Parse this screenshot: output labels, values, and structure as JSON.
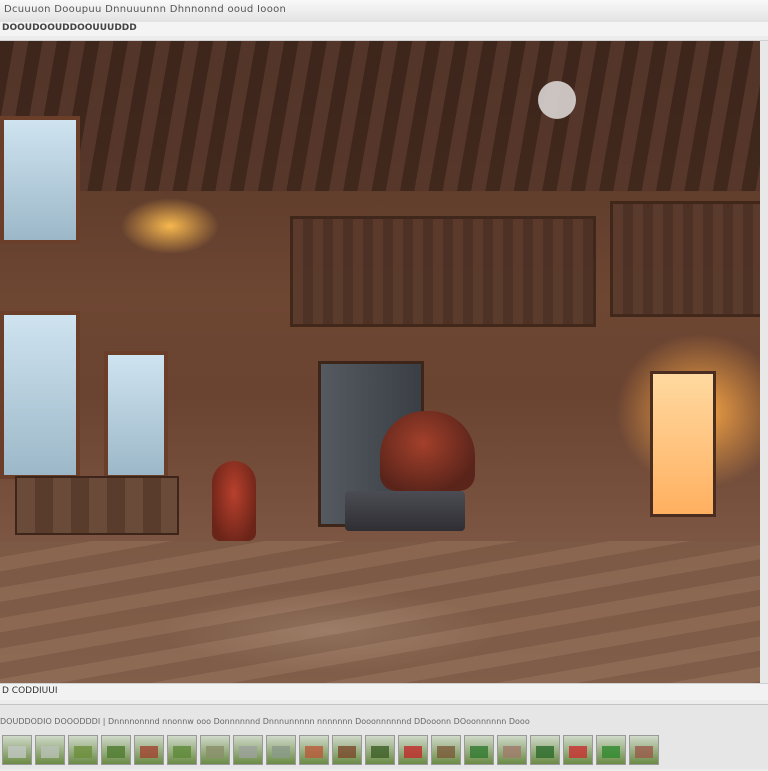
{
  "window": {
    "title": "Dcuuuon Dooupuu Dnnuuunnn Dhnnonnd ooud Iooon"
  },
  "toolbar": {
    "path_label": "DOOUDOOUDDOOUUUDDD"
  },
  "viewer": {
    "image_name": "rendered interior scene"
  },
  "status": {
    "text": "D CODDIUUI"
  },
  "filmstrip": {
    "caption": "DOUDDODIO DOOODDDI |  Dnnnnonnnd nnonnw ooo Donnnnnnd Dnnnunnnnn nnnnnnn Dooonnnnnnd        DDooonn   DOoonnnnnn  Dooo"
  },
  "thumbnails": [
    {
      "icon": "image-thumbnail",
      "accent": "#c0c7c2"
    },
    {
      "icon": "image-thumbnail",
      "accent": "#b9c0b6"
    },
    {
      "icon": "image-thumbnail",
      "accent": "#6b8f3a"
    },
    {
      "icon": "image-thumbnail",
      "accent": "#4e7a2e"
    },
    {
      "icon": "image-thumbnail",
      "accent": "#a04530"
    },
    {
      "icon": "image-thumbnail",
      "accent": "#5c8a37"
    },
    {
      "icon": "image-thumbnail",
      "accent": "#8a8f6a"
    },
    {
      "icon": "image-thumbnail",
      "accent": "#9ca09c"
    },
    {
      "icon": "image-thumbnail",
      "accent": "#8a9a88"
    },
    {
      "icon": "image-thumbnail",
      "accent": "#b95a3a"
    },
    {
      "icon": "image-thumbnail",
      "accent": "#7a4a2a"
    },
    {
      "icon": "image-thumbnail",
      "accent": "#3c5f27"
    },
    {
      "icon": "image-thumbnail",
      "accent": "#c02a2a"
    },
    {
      "icon": "image-thumbnail",
      "accent": "#7a5a3a"
    },
    {
      "icon": "image-thumbnail",
      "accent": "#2f7a2f"
    },
    {
      "icon": "image-thumbnail",
      "accent": "#a07a6a"
    },
    {
      "icon": "image-thumbnail",
      "accent": "#2a6a2a"
    },
    {
      "icon": "image-thumbnail",
      "accent": "#c83030"
    },
    {
      "icon": "image-thumbnail",
      "accent": "#2e8a2e"
    },
    {
      "icon": "image-thumbnail",
      "accent": "#9a5a4a"
    }
  ]
}
